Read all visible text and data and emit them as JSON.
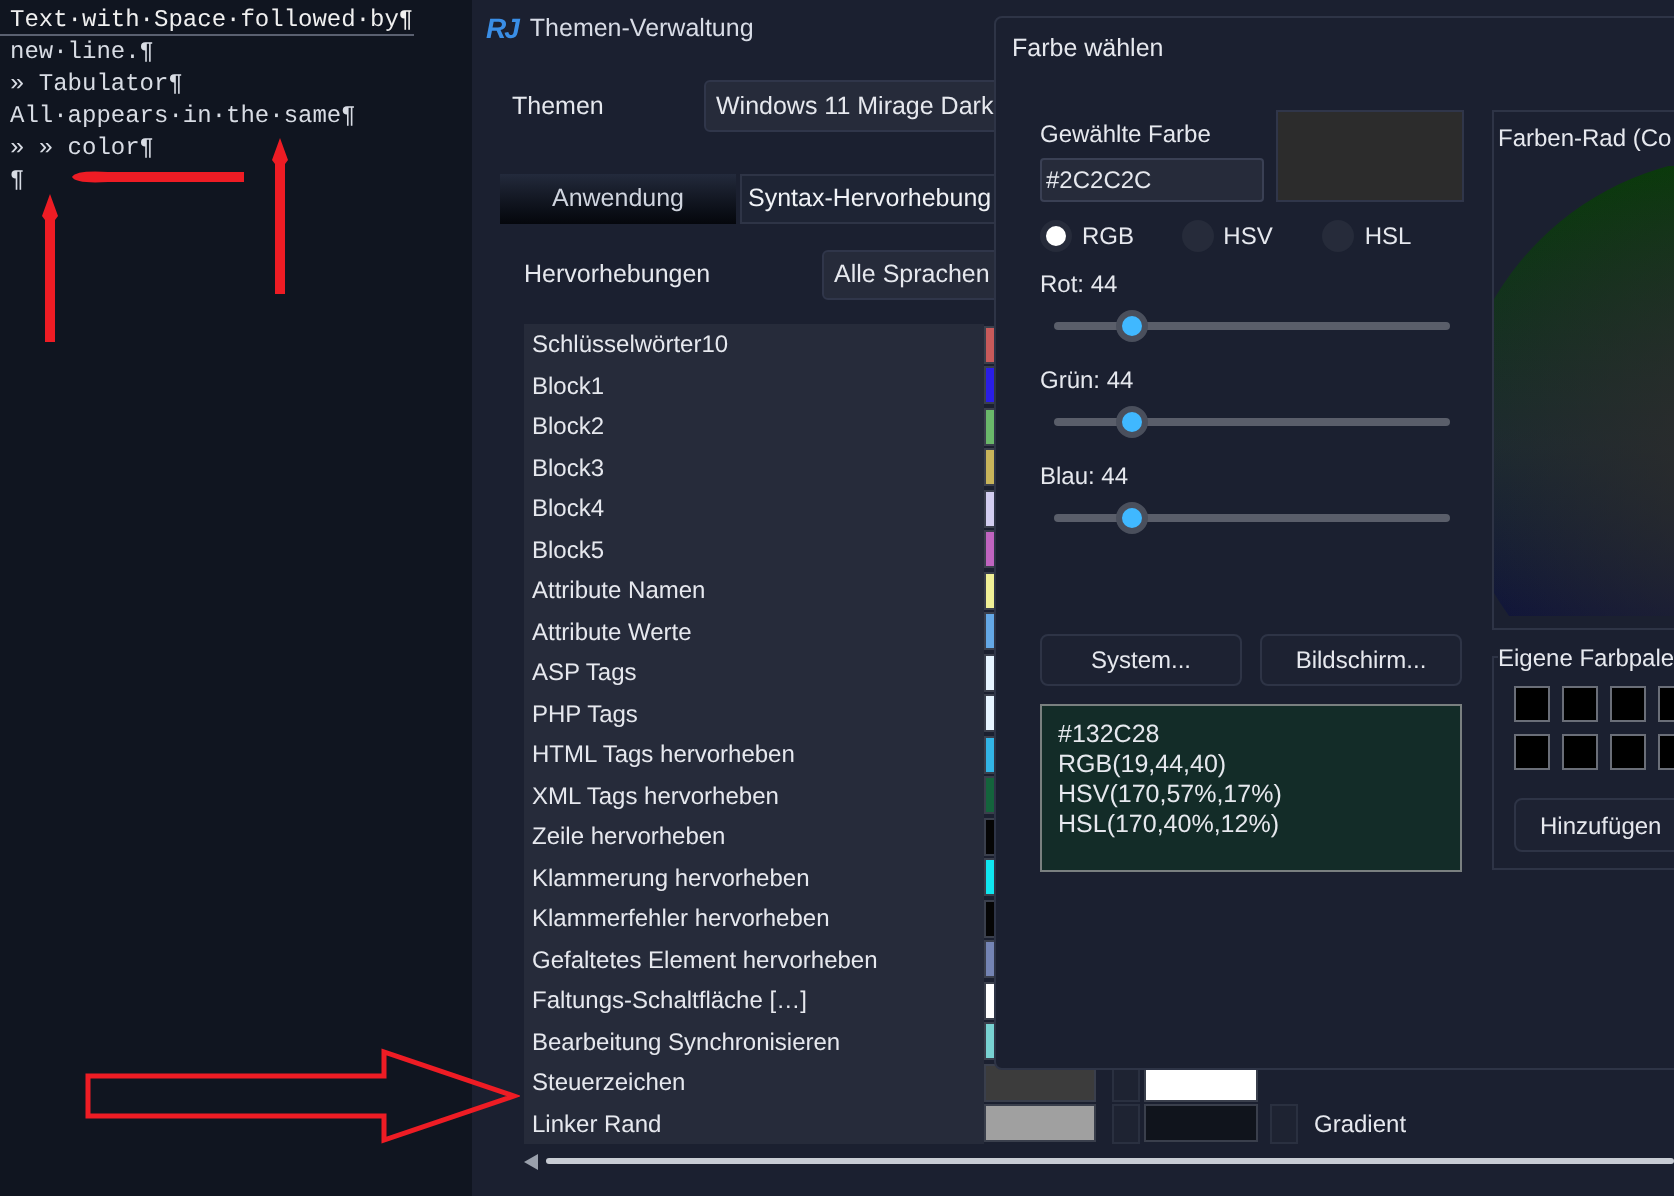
{
  "editor": {
    "lines": [
      {
        "text": "Text·with·Space·followed·by¶",
        "current": true
      },
      {
        "text": "new·line.¶",
        "current": false
      },
      {
        "text": "» Tabulator¶",
        "current": false
      },
      {
        "text": "All·appears·in·the·same¶",
        "current": false
      },
      {
        "text": "» » color¶",
        "current": false
      },
      {
        "text": "¶",
        "current": false
      }
    ]
  },
  "themes_window": {
    "logo": "RJ",
    "title": "Themen-Verwaltung",
    "themes_label": "Themen",
    "theme_value": "Windows 11 Mirage Dark",
    "tabs": [
      {
        "label": "Anwendung",
        "selected": false
      },
      {
        "label": "Syntax-Hervorhebung",
        "selected": true
      }
    ],
    "highlights_label": "Hervorhebungen",
    "language_value": "Alle Sprachen",
    "rows": [
      {
        "label": "Schlüsselwörter10",
        "color": "#c85a5a"
      },
      {
        "label": "Block1",
        "color": "#2a1ee6"
      },
      {
        "label": "Block2",
        "color": "#6ab86a"
      },
      {
        "label": "Block3",
        "color": "#c8b45a"
      },
      {
        "label": "Block4",
        "color": "#d2cdf0"
      },
      {
        "label": "Block5",
        "color": "#c064c0"
      },
      {
        "label": "Attribute Namen",
        "color": "#f0f096"
      },
      {
        "label": "Attribute Werte",
        "color": "#64a8e6"
      },
      {
        "label": "ASP Tags",
        "color": "#e6f4ff"
      },
      {
        "label": "PHP Tags",
        "color": "#e6f4ff"
      },
      {
        "label": "HTML Tags hervorheben",
        "color": "#32b4e6"
      },
      {
        "label": "XML Tags hervorheben",
        "color": "#14643c"
      },
      {
        "label": "Zeile hervorheben",
        "color": "#050505"
      },
      {
        "label": "Klammerung hervorheben",
        "color": "#10e6f0"
      },
      {
        "label": "Klammerfehler hervorheben",
        "color": "#050505"
      },
      {
        "label": "Gefaltetes Element hervorheben",
        "color": "#7484b4"
      },
      {
        "label": "Faltungs-Schaltfläche […]",
        "color": "#ffffff"
      },
      {
        "label": "Bearbeitung Synchronisieren",
        "color": "#78d2d2"
      },
      {
        "label": "Steuerzeichen",
        "color": "#3c3c3c",
        "background": {
          "checked": false,
          "color": "#ffffff"
        }
      },
      {
        "label": "Linker Rand",
        "color": "#a0a0a0",
        "background": {
          "checked": false,
          "color": "#10141c"
        },
        "gradient": {
          "label": "Gradient",
          "checked": false
        }
      }
    ]
  },
  "color_dialog": {
    "title": "Farbe wählen",
    "chosen_label": "Gewählte Farbe",
    "hex_value": "#2C2C2C",
    "modes": [
      {
        "label": "RGB",
        "selected": true
      },
      {
        "label": "HSV",
        "selected": false
      },
      {
        "label": "HSL",
        "selected": false
      }
    ],
    "sliders": [
      {
        "label": "Rot: 44",
        "level": 0.1725
      },
      {
        "label": "Grün: 44",
        "level": 0.1725
      },
      {
        "label": "Blau: 44",
        "level": 0.1725
      }
    ],
    "buttons": [
      "System...",
      "Bildschirm..."
    ],
    "info_lines": [
      "#132C28",
      "RGB(19,44,40)",
      "HSV(170,57%,17%)",
      "HSL(170,40%,12%)"
    ],
    "wheel_title": "Farben-Rad (Co",
    "palette_title": "Eigene Farbpale",
    "palette": [
      {
        "color": "#000000"
      },
      {
        "color": "#000000"
      },
      {
        "color": "#000000"
      },
      {
        "color": "#000000"
      },
      {
        "color": "#000000"
      },
      {
        "color": "#000000"
      },
      {
        "color": "#000000"
      },
      {
        "color": "#000000"
      }
    ],
    "add_button": "Hinzufügen"
  }
}
